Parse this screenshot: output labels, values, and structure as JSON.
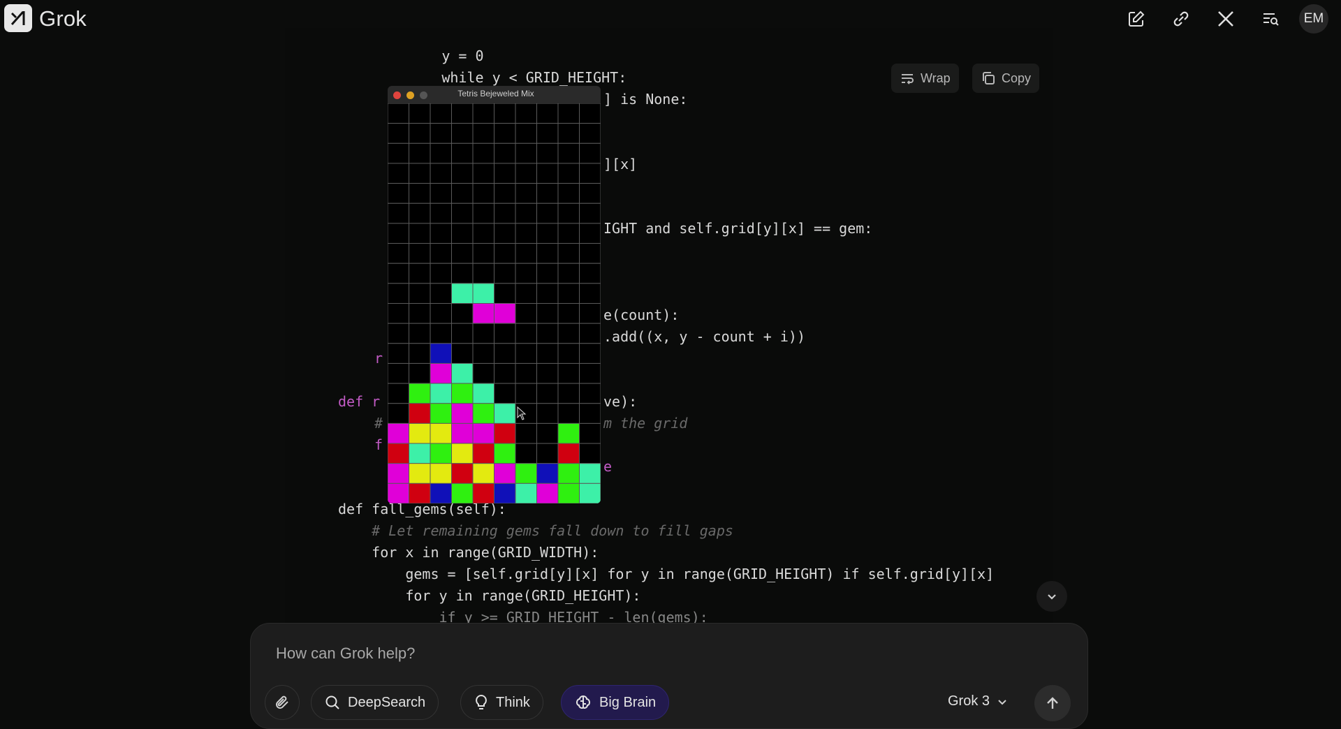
{
  "app": {
    "name": "Grok",
    "avatar_initials": "EM"
  },
  "header": {
    "icons": [
      "new-chat-icon",
      "link-icon",
      "x-logo-icon",
      "history-search-icon"
    ]
  },
  "code": {
    "wrap_label": "Wrap",
    "copy_label": "Copy",
    "lines": [
      "        y = 0",
      "        while y < GRID_HEIGHT:",
      "] is None:",
      "][x]",
      "IGHT and self.grid[y][x] == gem:",
      "e(count):",
      ".add((x, y - count + i))",
      "r",
      "def r",
      "ve):",
      "#",
      "m the grid",
      "f",
      "e",
      "def fall_gems(self):",
      "    # Let remaining gems fall down to fill gaps",
      "    for x in range(GRID_WIDTH):",
      "        gems = [self.grid[y][x] for y in range(GRID_HEIGHT) if self.grid[y][x]",
      "        for y in range(GRID_HEIGHT):",
      "            if y >= GRID_HEIGHT - len(gems):"
    ]
  },
  "game": {
    "title": "Tetris Bejeweled Mix",
    "cols": 10,
    "rows": 19,
    "colors": {
      "C": "#3df0a8",
      "M": "#e000d8",
      "B": "#1010b8",
      "G": "#2ff010",
      "R": "#d00010",
      "Y": "#e3ea10",
      "K": "#000000"
    },
    "cells": [
      "..........",
      "..........",
      "..........",
      "..........",
      "..........",
      "..........",
      "..........",
      "..........",
      "..........",
      "...CC.....",
      "....MM....",
      "..........",
      "..B.......",
      "..MC......",
      ".GCGC.....",
      ".RGMGC....",
      "MYYMMR..G.",
      "RCGYRG..R.",
      "MYYRYMGBGC",
      "MRBGRBCMGC"
    ]
  },
  "composer": {
    "placeholder": "How can Grok help?",
    "buttons": [
      {
        "label": "DeepSearch",
        "icon": "search-icon"
      },
      {
        "label": "Think",
        "icon": "lightbulb-icon"
      },
      {
        "label": "Big Brain",
        "icon": "brain-icon",
        "active": true
      }
    ],
    "model": "Grok 3"
  }
}
